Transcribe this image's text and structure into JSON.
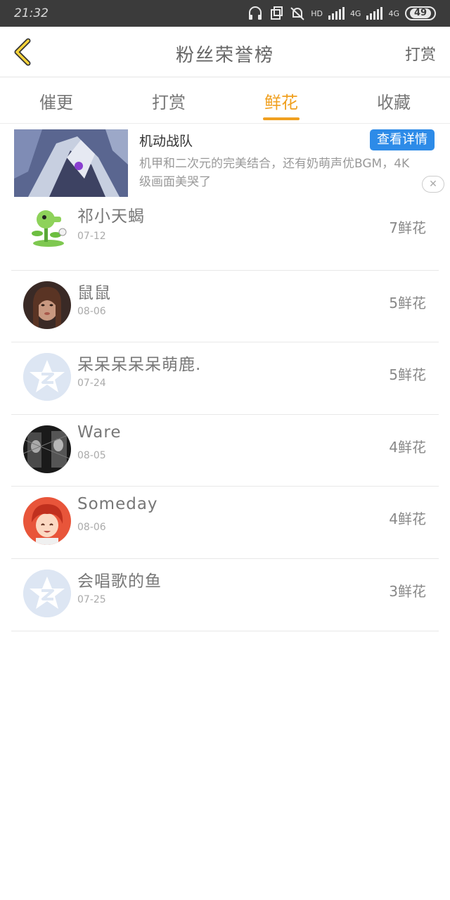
{
  "status_bar": {
    "time": "21:32",
    "network_hd": "HD",
    "network_1": "4G",
    "network_2": "4G",
    "battery": "49"
  },
  "header": {
    "title": "粉丝荣誉榜",
    "action": "打赏"
  },
  "tabs": [
    {
      "label": "催更",
      "active": false
    },
    {
      "label": "打赏",
      "active": false
    },
    {
      "label": "鲜花",
      "active": true
    },
    {
      "label": "收藏",
      "active": false
    }
  ],
  "ad": {
    "title": "机动战队",
    "button": "查看详情",
    "description": "机甲和二次元的完美结合，还有奶萌声优BGM，4K级画面美哭了",
    "close": "✕"
  },
  "list": [
    {
      "name": "祁小天蝎",
      "date": "07-12",
      "count": "7鲜花",
      "avatar": "plant-avatar"
    },
    {
      "name": "鼠鼠",
      "date": "08-06",
      "count": "5鲜花",
      "avatar": "girl-photo-avatar"
    },
    {
      "name": "呆呆呆呆呆萌鹿.",
      "date": "07-24",
      "count": "5鲜花",
      "avatar": "default-avatar"
    },
    {
      "name": "Ware",
      "date": "08-05",
      "count": "4鲜花",
      "avatar": "bw-photo-avatar"
    },
    {
      "name": "Someday",
      "date": "08-06",
      "count": "4鲜花",
      "avatar": "anime-avatar"
    },
    {
      "name": "会唱歌的鱼",
      "date": "07-25",
      "count": "3鲜花",
      "avatar": "default-avatar"
    }
  ],
  "colors": {
    "accent": "#f0a020",
    "status_bar": "#3b3b3b",
    "ad_button": "#2d8be8",
    "default_avatar": "#dde6f3"
  }
}
